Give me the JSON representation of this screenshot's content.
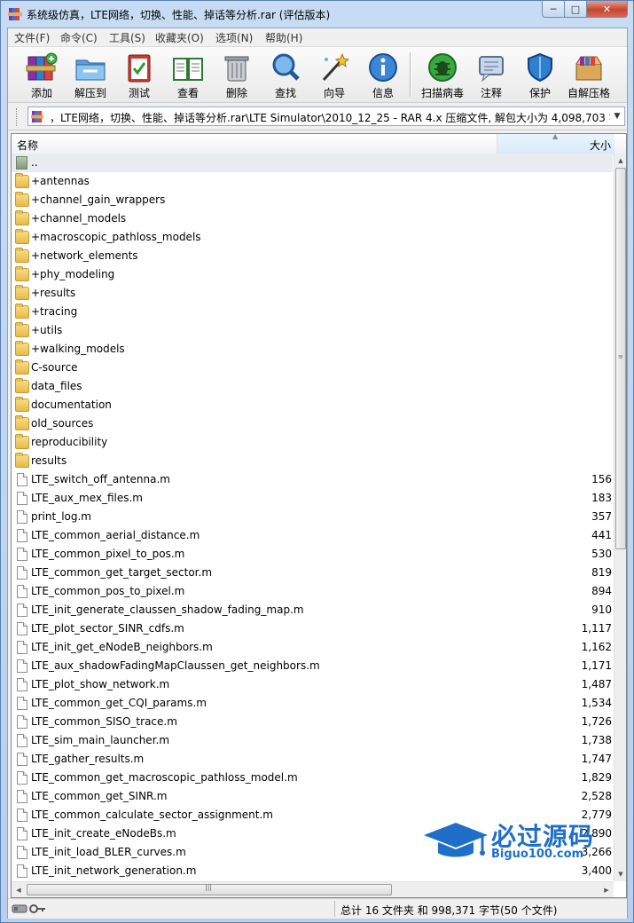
{
  "window": {
    "title": "系统级仿真，LTE网络，切换、性能、掉话等分析.rar (评估版本)",
    "minimize": "─",
    "maximize": "□",
    "close": "✕"
  },
  "menubar": [
    "文件(F)",
    "命令(C)",
    "工具(S)",
    "收藏夹(O)",
    "选项(N)",
    "帮助(H)"
  ],
  "toolbar": [
    {
      "label": "添加",
      "icon": "add-books-icon"
    },
    {
      "label": "解压到",
      "icon": "extract-folder-icon"
    },
    {
      "label": "测试",
      "icon": "test-clipboard-icon"
    },
    {
      "label": "查看",
      "icon": "view-book-icon"
    },
    {
      "label": "删除",
      "icon": "trash-icon"
    },
    {
      "label": "查找",
      "icon": "find-magnifier-icon"
    },
    {
      "label": "向导",
      "icon": "wizard-wand-icon"
    },
    {
      "label": "信息",
      "icon": "info-icon"
    },
    {
      "label": "扫描病毒",
      "icon": "virus-scan-icon"
    },
    {
      "label": "注释",
      "icon": "comment-icon"
    },
    {
      "label": "保护",
      "icon": "shield-icon"
    },
    {
      "label": "自解压格",
      "icon": "sfx-box-icon"
    }
  ],
  "address": {
    "text": "，LTE网络，切换、性能、掉话等分析.rar\\LTE Simulator\\2010_12_25 - RAR 4.x 压缩文件, 解包大小为 4,098,703 字节",
    "dropdown": "▼"
  },
  "columns": {
    "name": "名称",
    "size": "大小",
    "sort_indicator": "▲"
  },
  "files": [
    {
      "name": "..",
      "size": "",
      "type": "updir"
    },
    {
      "name": "+antennas",
      "size": "",
      "type": "folder"
    },
    {
      "name": "+channel_gain_wrappers",
      "size": "",
      "type": "folder"
    },
    {
      "name": "+channel_models",
      "size": "",
      "type": "folder"
    },
    {
      "name": "+macroscopic_pathloss_models",
      "size": "",
      "type": "folder"
    },
    {
      "name": "+network_elements",
      "size": "",
      "type": "folder"
    },
    {
      "name": "+phy_modeling",
      "size": "",
      "type": "folder"
    },
    {
      "name": "+results",
      "size": "",
      "type": "folder"
    },
    {
      "name": "+tracing",
      "size": "",
      "type": "folder"
    },
    {
      "name": "+utils",
      "size": "",
      "type": "folder"
    },
    {
      "name": "+walking_models",
      "size": "",
      "type": "folder"
    },
    {
      "name": "C-source",
      "size": "",
      "type": "folder"
    },
    {
      "name": "data_files",
      "size": "",
      "type": "folder"
    },
    {
      "name": "documentation",
      "size": "",
      "type": "folder"
    },
    {
      "name": "old_sources",
      "size": "",
      "type": "folder"
    },
    {
      "name": "reproducibility",
      "size": "",
      "type": "folder"
    },
    {
      "name": "results",
      "size": "",
      "type": "folder"
    },
    {
      "name": "LTE_switch_off_antenna.m",
      "size": "156",
      "type": "file"
    },
    {
      "name": "LTE_aux_mex_files.m",
      "size": "183",
      "type": "file"
    },
    {
      "name": "print_log.m",
      "size": "357",
      "type": "file"
    },
    {
      "name": "LTE_common_aerial_distance.m",
      "size": "441",
      "type": "file"
    },
    {
      "name": "LTE_common_pixel_to_pos.m",
      "size": "530",
      "type": "file"
    },
    {
      "name": "LTE_common_get_target_sector.m",
      "size": "819",
      "type": "file"
    },
    {
      "name": "LTE_common_pos_to_pixel.m",
      "size": "894",
      "type": "file"
    },
    {
      "name": "LTE_init_generate_claussen_shadow_fading_map.m",
      "size": "910",
      "type": "file"
    },
    {
      "name": "LTE_plot_sector_SINR_cdfs.m",
      "size": "1,117",
      "type": "file"
    },
    {
      "name": "LTE_init_get_eNodeB_neighbors.m",
      "size": "1,162",
      "type": "file"
    },
    {
      "name": "LTE_aux_shadowFadingMapClaussen_get_neighbors.m",
      "size": "1,171",
      "type": "file"
    },
    {
      "name": "LTE_plot_show_network.m",
      "size": "1,487",
      "type": "file"
    },
    {
      "name": "LTE_common_get_CQI_params.m",
      "size": "1,534",
      "type": "file"
    },
    {
      "name": "LTE_common_SISO_trace.m",
      "size": "1,726",
      "type": "file"
    },
    {
      "name": "LTE_sim_main_launcher.m",
      "size": "1,738",
      "type": "file"
    },
    {
      "name": "LTE_gather_results.m",
      "size": "1,747",
      "type": "file"
    },
    {
      "name": "LTE_common_get_macroscopic_pathloss_model.m",
      "size": "1,829",
      "type": "file"
    },
    {
      "name": "LTE_common_get_SINR.m",
      "size": "2,528",
      "type": "file"
    },
    {
      "name": "LTE_common_calculate_sector_assignment.m",
      "size": "2,779",
      "type": "file"
    },
    {
      "name": "LTE_init_create_eNodeBs.m",
      "size": "2,890",
      "type": "file"
    },
    {
      "name": "LTE_init_load_BLER_curves.m",
      "size": "3,266",
      "type": "file"
    },
    {
      "name": "LTE_init_network_generation.m",
      "size": "3,400",
      "type": "file"
    }
  ],
  "status": {
    "text": "总计 16 文件夹 和 998,371 字节(50 个文件)"
  },
  "watermark": {
    "text": "必过源码",
    "sub": "Biguo100.com"
  },
  "scroll": {
    "up": "▲",
    "down": "▼",
    "left": "◀",
    "right": "▶",
    "grip": "≡",
    "hgrip": "|||"
  }
}
